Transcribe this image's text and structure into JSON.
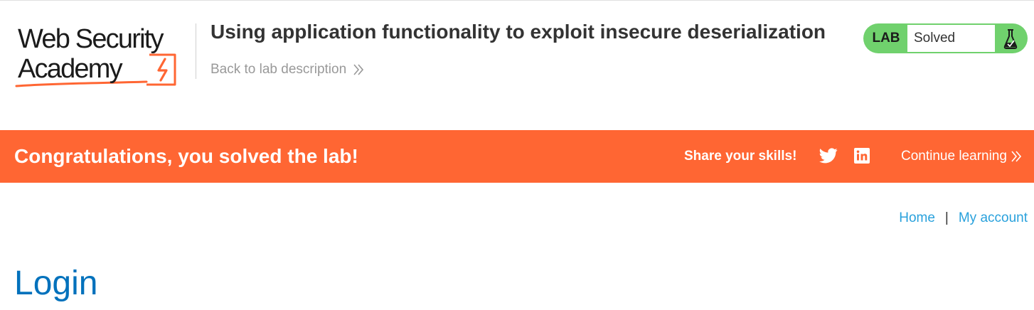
{
  "header": {
    "logo_line1": "Web Security",
    "logo_line2": "Academy",
    "lab_title": "Using application functionality to exploit insecure deserialization",
    "back_link": "Back to lab description",
    "back_icon": "double-chevron-right-icon",
    "lab_status": {
      "tag": "LAB",
      "state": "Solved",
      "icon": "flask-icon",
      "color": "#70d16d"
    }
  },
  "banner": {
    "message": "Congratulations, you solved the lab!",
    "share_label": "Share your skills!",
    "share_icons": [
      "twitter-icon",
      "linkedin-icon"
    ],
    "continue_label": "Continue learning",
    "background": "#ff6633"
  },
  "nav": {
    "home": "Home",
    "separator": "|",
    "my_account": "My account",
    "link_color": "#29a1dc"
  },
  "main": {
    "heading": "Login",
    "heading_color": "#0071bc"
  }
}
